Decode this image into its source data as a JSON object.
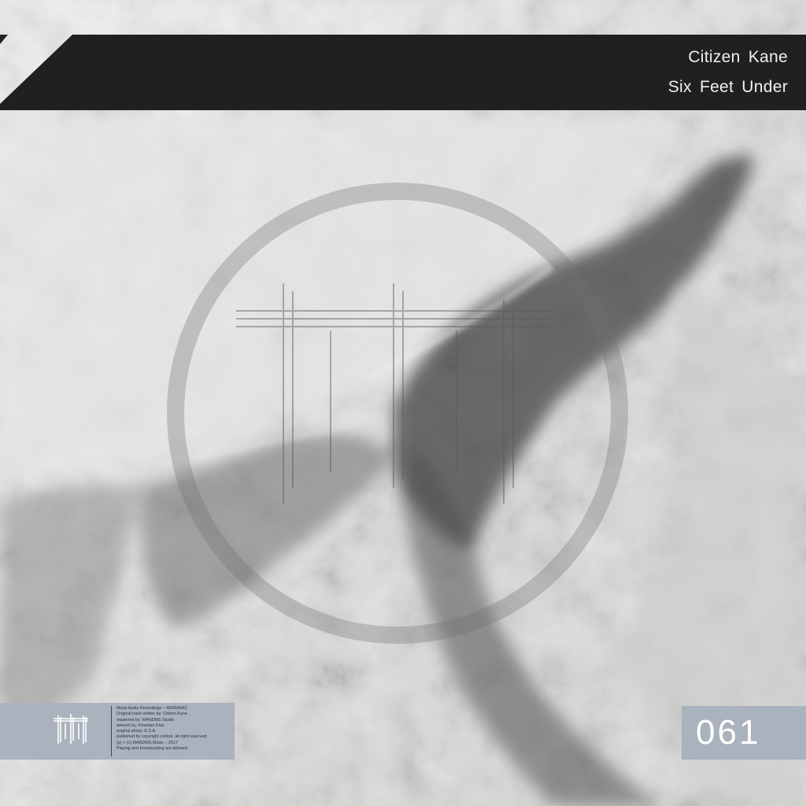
{
  "release": {
    "artist": "Citizen Kane",
    "title": "Six Feet Under",
    "catalog_number": "061"
  },
  "credits": [
    "Moira Audio Recordings – MOIRA061",
    "Original track written by: Citizen Kane",
    "mastered by: MANDMS Studio",
    "artwork by: Krisztian Kiss",
    "original photo: E.S.A.",
    "published by copyright control. all right reserved.",
    "(p) + (c) MANDMS Music – 2017",
    "Playing and broadcasting are allowed."
  ],
  "icons": {
    "label_logo": "moira-label-logo-icon",
    "emblem": "circle-emblem-icon"
  },
  "colors": {
    "banner": "#202020",
    "banner_text": "#f0f0f0",
    "info_panel": "#a9b2bd",
    "catalog_text": "#ffffff"
  }
}
